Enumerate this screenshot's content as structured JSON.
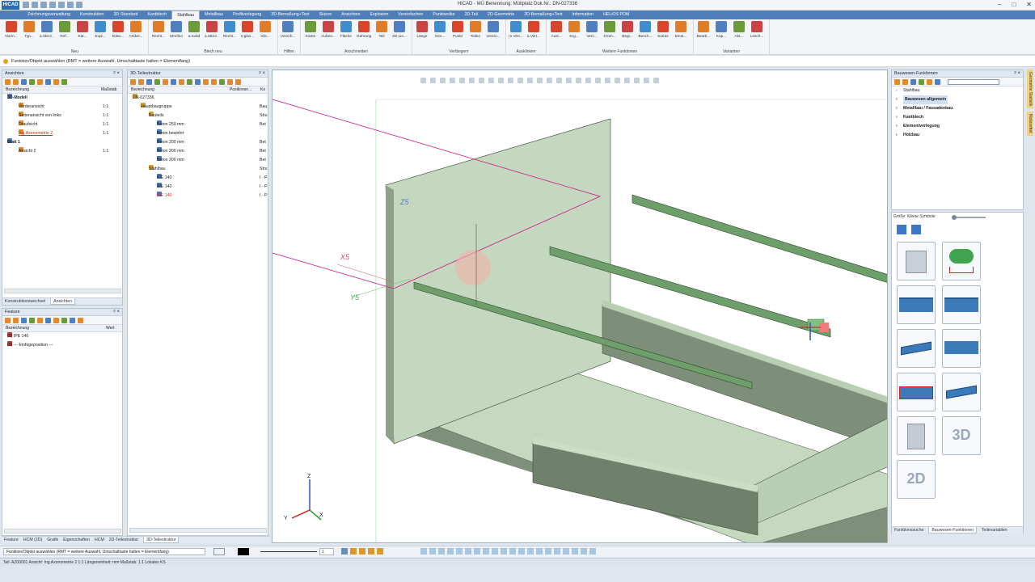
{
  "window": {
    "title": "HiCAD - MÜ  Benennung: Müllplatz  Dok.Nr.: DN-027336",
    "logo": "HiCAD"
  },
  "tabs": [
    "Zeichnungsverwaltung",
    "Konstruktion",
    "3D-Standard",
    "Kantblech",
    "Stahlbau",
    "Metallbau",
    "Profilverlegung",
    "3D-Bemaßung+Text",
    "Skizze",
    "Ansichten",
    "Explosion",
    "Vereinfachen",
    "Punktwolke",
    "2D-Teil",
    "2D-Geometrie",
    "2D-Bemaßung+Text",
    "Information",
    "HELiOS PDM"
  ],
  "active_tab": "Stahlbau",
  "ribbon": {
    "groups": [
      {
        "label": "Neu",
        "buttons": [
          "Norm...",
          "Typ...",
          "a.Skizz...",
          "Ref...",
          "Kat...",
          "Expl...",
          "Doku...",
          "Artikel..."
        ]
      },
      {
        "label": "Blech neu",
        "buttons": [
          "Recht...",
          "Streifen",
          "a.Solid",
          "a.Skizz...",
          "Recht...",
          "V.glas...",
          "Gitt..."
        ]
      },
      {
        "label": "Hilfen",
        "buttons": [
          "Versch..."
        ]
      },
      {
        "label": "Anschneiden",
        "buttons": [
          "Kante",
          "Außen...",
          "Fläche",
          "Gehrung",
          "Teil",
          "2D-Lin..."
        ]
      },
      {
        "label": "Verlängern",
        "buttons": [
          "Länge",
          "Ges...",
          "Punkt",
          "Teilen",
          "Verein..."
        ]
      },
      {
        "label": "Ausklinken",
        "buttons": [
          "m.Vert...",
          "a.Vert..."
        ]
      },
      {
        "label": "Weitere Funktionen",
        "buttons": [
          "Ausl...",
          "Erg...",
          "Verz...",
          "Krüm...",
          "Begr...",
          "Besch...",
          "Extras",
          "Einst..."
        ]
      },
      {
        "label": "Varianten",
        "buttons": [
          "Bearb...",
          "Kop...",
          "Akt...",
          "Lösch..."
        ]
      }
    ]
  },
  "status_prompt": "Funktion/Objekt auswählen (RMT = weitere Auswahl, Umschalttaste halten = Elementfang)",
  "views_panel": {
    "title": "Ansichten",
    "columns": [
      "Bezeichnung",
      "Maßstab"
    ],
    "rows": [
      {
        "name": "3D-Modell",
        "scale": "",
        "level": 0,
        "bold": true
      },
      {
        "name": "Vorderansicht",
        "scale": "1:1",
        "level": 1
      },
      {
        "name": "Seitenansicht von links",
        "scale": "1:1",
        "level": 1
      },
      {
        "name": "Draufsicht",
        "scale": "1:1",
        "level": 1
      },
      {
        "name": "Ing.Axonometrie 2",
        "scale": "1:1",
        "level": 1,
        "red": true
      },
      {
        "name": "Blatt 1",
        "scale": "",
        "level": 0,
        "bold": true
      },
      {
        "name": "Ansicht 2",
        "scale": "1:1",
        "level": 1
      }
    ],
    "tabs": [
      "Konstruktionswechsel",
      "Ansichten"
    ]
  },
  "feature_panel": {
    "title": "Feature",
    "columns": [
      "Bezeichnung",
      "Wert"
    ],
    "rows": [
      {
        "name": "(1) IPE 140"
      },
      {
        "name": "(2) --- Einfügeposition ---"
      }
    ]
  },
  "structure_panel": {
    "title": "3D-Teilestruktur",
    "columns": [
      "Bezeichnung",
      "Positionsn...",
      "Ko"
    ],
    "rows": [
      {
        "name": "DN-027336",
        "col2": "",
        "col3": "",
        "level": 0
      },
      {
        "name": "Hauptbaugruppe",
        "col2": "",
        "col3": "Bau",
        "level": 1
      },
      {
        "name": "Bauteils",
        "col2": "",
        "col3": "Stru",
        "level": 2
      },
      {
        "name": "Beton 250 mm",
        "col2": "",
        "col3": "Bet",
        "level": 3
      },
      {
        "name": "Beton bewehrt",
        "col2": "",
        "col3": "",
        "level": 3
      },
      {
        "name": "Beton 200 mm",
        "col2": "",
        "col3": "Bet",
        "level": 3
      },
      {
        "name": "Beton 200 mm",
        "col2": "",
        "col3": "Bet",
        "level": 3
      },
      {
        "name": "Beton 200 mm",
        "col2": "",
        "col3": "Bet",
        "level": 3
      },
      {
        "name": "Stahlbau",
        "col2": "",
        "col3": "Stru",
        "level": 2
      },
      {
        "name": "IPE 140",
        "col2": "",
        "col3": "I - P",
        "level": 3
      },
      {
        "name": "IPE 140",
        "col2": "",
        "col3": "I - P",
        "level": 3
      },
      {
        "name": "IPE 140",
        "col2": "",
        "col3": "I - P",
        "level": 3,
        "red": true
      }
    ]
  },
  "left_bottom_tabs": [
    "Feature",
    "HCM (2D)",
    "Grafik",
    "Eigenschaften",
    "HCM",
    "2D-Teilestruktur",
    "3D-Teilestruktur"
  ],
  "viewport": {
    "labels": {
      "z5": "Z5",
      "x5": "X5",
      "y5": "Y5"
    },
    "axes": {
      "z": "Z",
      "y": "Y",
      "x": "X"
    }
  },
  "right_panel": {
    "title": "Bauwesen-Funktionen",
    "items": [
      {
        "label": "Stahlbau",
        "bold": false
      },
      {
        "label": "Bauwesen allgemein",
        "bold": true,
        "selected": true
      },
      {
        "label": "Metallbau / Fassadenbau",
        "bold": true
      },
      {
        "label": "Kantblech",
        "bold": true
      },
      {
        "label": "Elementverlegung",
        "bold": true
      },
      {
        "label": "Holzbau",
        "bold": true
      }
    ],
    "size_label": "Größe:",
    "size_hint": "Kleine Symbole",
    "tile_labels": {
      "t11": "3D",
      "t12": "2D"
    },
    "bottom_tabs": [
      "Funktionssuche",
      "Bauwesen-Funktionen",
      "Teilevariablen"
    ]
  },
  "side_tabs": [
    "Geometrie Statistik",
    "Notizzettel"
  ],
  "bottom_toolbar": {
    "number_value": "1"
  },
  "statusbar": {
    "text": "Teil: AZ00001   Ansicht: Ing.Axonometrie 2  1:1   Längeneinheit: mm   Maßstab: 1:1   Lokales KS"
  },
  "colors": {
    "ribbon_tab_bar": "#4e7fb8",
    "beam": "#6e9f6b",
    "concrete": "#c6dcc0",
    "accent_red": "#d22222",
    "selection_magenta": "#d0258c"
  }
}
